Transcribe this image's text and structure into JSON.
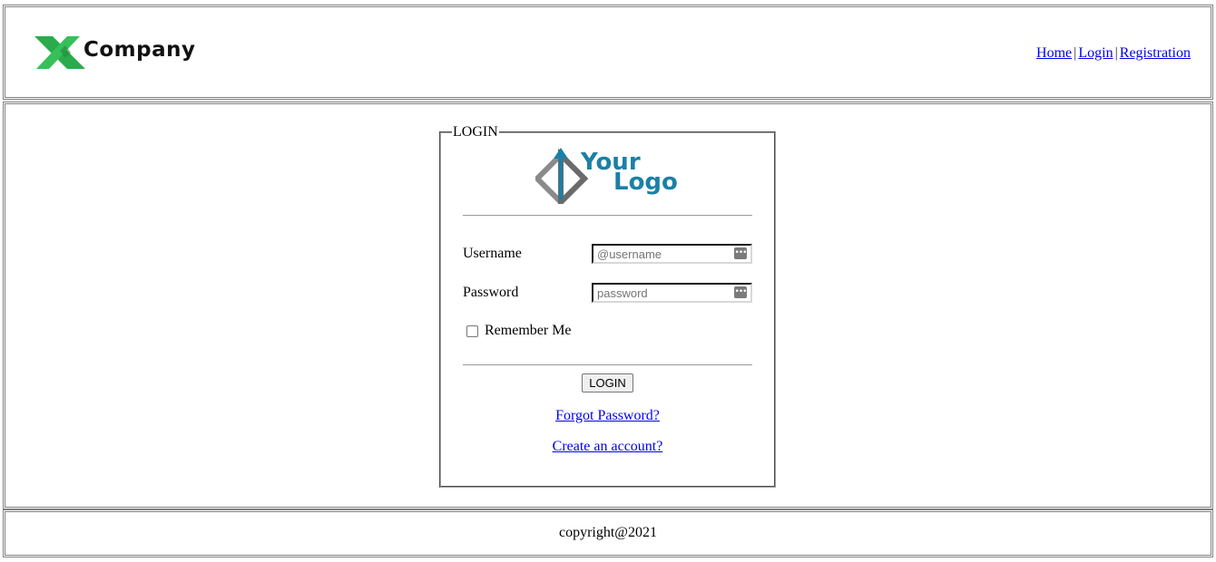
{
  "header": {
    "brand": "Company",
    "brand_icon": "x-logo-icon",
    "brand_color": "#2bab4b",
    "nav": {
      "home": "Home",
      "login": "Login",
      "registration": "Registration",
      "separator": "|"
    }
  },
  "login_form": {
    "legend": "LOGIN",
    "logo": {
      "line1": "Your",
      "line2": "Logo",
      "color": "#1b80a6"
    },
    "username": {
      "label": "Username",
      "placeholder": "@username",
      "value": ""
    },
    "password": {
      "label": "Password",
      "placeholder": "password",
      "value": ""
    },
    "remember_me": {
      "label": "Remember Me",
      "checked": false
    },
    "submit_label": "LOGIN",
    "forgot_password": "Forgot Password?",
    "create_account": "Create an account?"
  },
  "footer": {
    "copyright": "copyright@2021"
  }
}
